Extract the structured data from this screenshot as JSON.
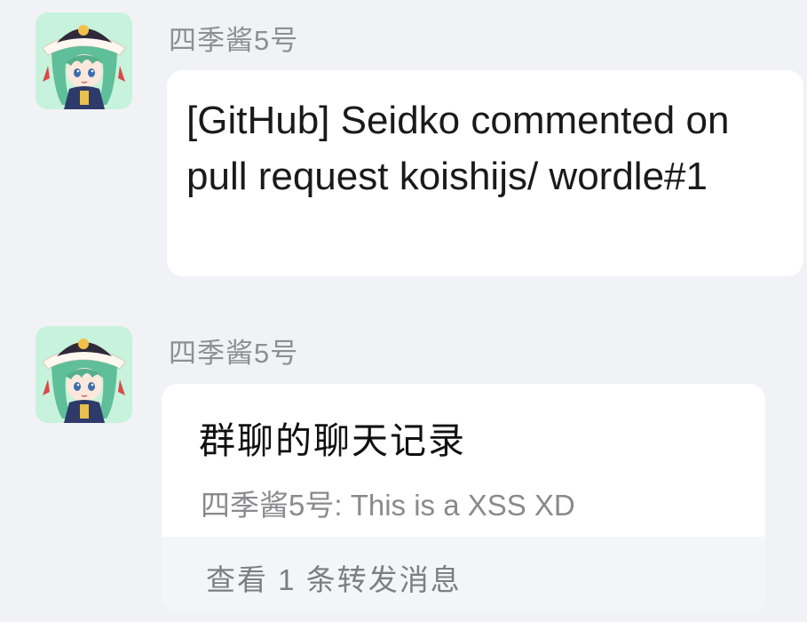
{
  "messages": [
    {
      "sender": "四季酱5号",
      "text": "[GitHub] Seidko commented on pull request koishijs/ wordle#1"
    },
    {
      "sender": "四季酱5号",
      "forward": {
        "title": "群聊的聊天记录",
        "preview": "四季酱5号: This is a XSS XD",
        "footer": "查看 1 条转发消息"
      }
    }
  ],
  "icons": {
    "avatar": "anime-character-avatar"
  },
  "colors": {
    "background": "#f1f2f6",
    "bubble": "#ffffff",
    "sender_name": "#8e8e93",
    "avatar_bg": "#c7f2dc"
  }
}
